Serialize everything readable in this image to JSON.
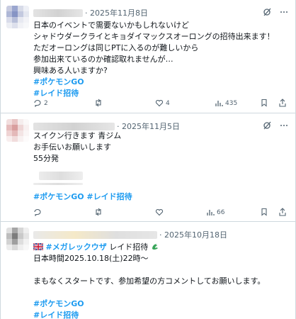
{
  "posts": [
    {
      "date": "· 2025年11月8日",
      "lines": [
        "日本のイベントで需要ないかもしれないけど",
        "シャドウダークライとキョダイマックスオーロングの招待出来ます！",
        "ただオーロングは同じPTに入るのが難しいから",
        "参加出来ているのか確認取れませんが…",
        "興味ある人いますか?"
      ],
      "tags": [
        "#ポケモンGO",
        "#レイド招待"
      ],
      "actions": {
        "reply": "2",
        "retweet": "",
        "like": "4",
        "views": "435"
      }
    },
    {
      "date": "· 2025年11月5日",
      "lines": [
        "スイクン行きます 青ジム",
        "お手伝いお願いします",
        "55分発"
      ],
      "tags": [
        "#ポケモンGO #レイド招待"
      ],
      "actions": {
        "reply": "",
        "retweet": "",
        "like": "",
        "views": "66"
      }
    },
    {
      "date": "· 2025年10月18日",
      "first_line_tag": "#メガレックウザ",
      "first_line_rest": " レイド招待",
      "lines": [
        "日本時間2025.10.18(土)22時～",
        "",
        "まもなくスタートです、参加希望の方コメントしてお願いします。",
        ""
      ],
      "tags": [
        "#ポケモンGO",
        "#レイド招待"
      ]
    }
  ],
  "colors": {
    "text": "#0f1419",
    "muted": "#536471",
    "accent": "#1d9bf0",
    "border": "#cfd9de"
  },
  "icons": [
    "grok-icon",
    "more-icon",
    "reply-icon",
    "retweet-icon",
    "like-icon",
    "views-icon",
    "bookmark-icon",
    "share-icon",
    "uk-flag-icon",
    "dragon-icon"
  ]
}
